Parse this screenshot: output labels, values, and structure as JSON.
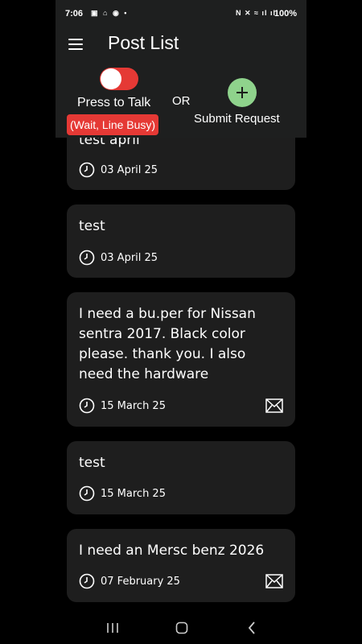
{
  "status": {
    "time": "7:06",
    "left_icons": "▣ ⌂ ◉ •",
    "right_icons": "N ✕ ≈ ıl ıl",
    "battery": "100%"
  },
  "header": {
    "title": "Post List",
    "menu_icon": "hamburger-menu-icon",
    "ptt_label": "Press to Talk",
    "toggle_on": true,
    "or_label": "OR",
    "busy_label": "(Wait, Line Busy)",
    "submit_label": "Submit Request",
    "add_icon": "plus-icon"
  },
  "posts": [
    {
      "text": "test april",
      "date": "03 April 25",
      "has_mail": false
    },
    {
      "text": "test",
      "date": "03 April 25",
      "has_mail": false
    },
    {
      "text": "I need a bu.per for Nissan sentra 2017. Black color please. thank you. I also need the hardware",
      "date": "15 March 25",
      "has_mail": true
    },
    {
      "text": "test",
      "date": "15 March 25",
      "has_mail": false
    },
    {
      "text": "I need an Mersc benz 2026",
      "date": "07 February 25",
      "has_mail": true
    }
  ],
  "nav": {
    "recents_icon": "recents-icon",
    "home_icon": "home-icon",
    "back_icon": "back-icon"
  },
  "colors": {
    "accent_red": "#e53935",
    "add_green": "#8fd38c",
    "card_bg": "#1e1e1e",
    "header_bg": "#1e1f1f"
  }
}
